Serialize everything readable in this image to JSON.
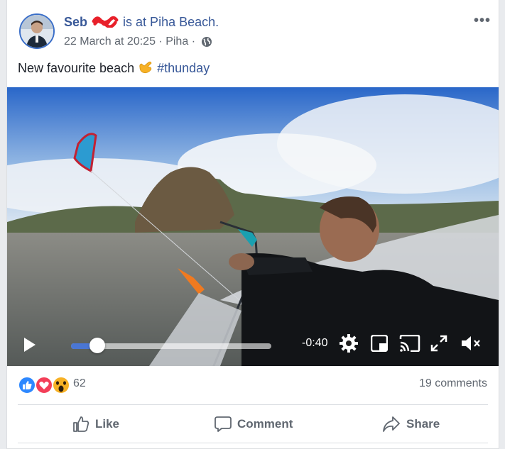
{
  "post": {
    "author": "Seb",
    "checkin_text": "is at Piha Beach.",
    "date": "22 March at 20:25",
    "separator": "·",
    "location": "Piha",
    "more_label": "•••",
    "text": "New favourite beach",
    "hashtag": "#thunday"
  },
  "video": {
    "time_remaining": "-0:40",
    "progress": 0.13
  },
  "reactions": {
    "count": "62",
    "types": [
      "like-icon",
      "love-icon",
      "wow-icon"
    ],
    "comments": "19 comments"
  },
  "actions": {
    "like": "Like",
    "comment": "Comment",
    "share": "Share"
  },
  "colors": {
    "brand_blue": "#385898",
    "like_blue": "#2d88ff",
    "love_red": "#f33e58",
    "wow_yellow": "#f7b125"
  }
}
